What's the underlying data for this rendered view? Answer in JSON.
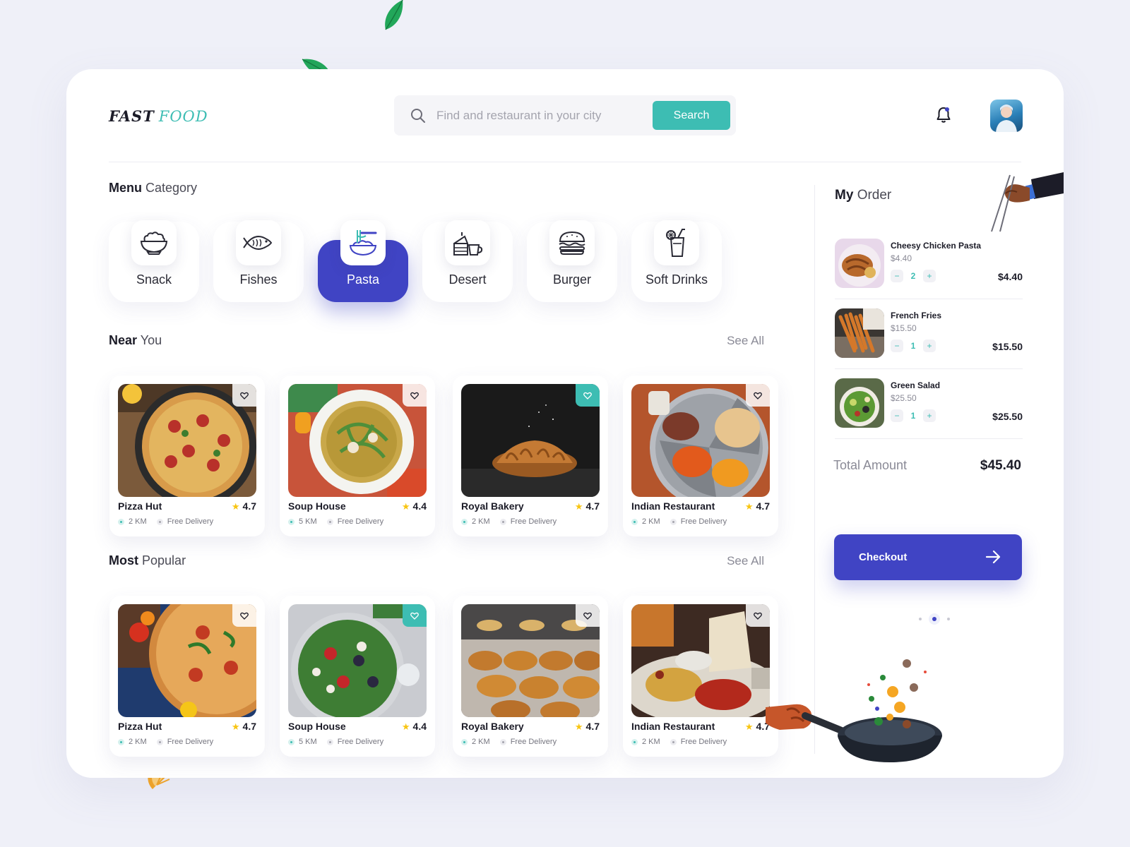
{
  "brand": {
    "part1": "FAST",
    "part2": "FOOD"
  },
  "search": {
    "placeholder": "Find and restaurant in your city",
    "button": "Search"
  },
  "menu": {
    "title_bold": "Menu",
    "title_rest": "Category",
    "categories": [
      {
        "label": "Snack",
        "icon": "salad-bowl-icon"
      },
      {
        "label": "Fishes",
        "icon": "fish-icon"
      },
      {
        "label": "Pasta",
        "icon": "noodle-bowl-icon",
        "active": true
      },
      {
        "label": "Desert",
        "icon": "cake-coffee-icon"
      },
      {
        "label": "Burger",
        "icon": "burger-icon"
      },
      {
        "label": "Soft Drinks",
        "icon": "drink-icon"
      }
    ]
  },
  "near": {
    "title_bold": "Near",
    "title_rest": "You",
    "see_all": "See All",
    "items": [
      {
        "name": "Pizza Hut",
        "rating": "4.7",
        "distance": "2 KM",
        "delivery": "Free Delivery",
        "favorite": false
      },
      {
        "name": "Soup House",
        "rating": "4.4",
        "distance": "5 KM",
        "delivery": "Free Delivery",
        "favorite": false
      },
      {
        "name": "Royal Bakery",
        "rating": "4.7",
        "distance": "2 KM",
        "delivery": "Free Delivery",
        "favorite": true
      },
      {
        "name": "Indian Restaurant",
        "rating": "4.7",
        "distance": "2 KM",
        "delivery": "Free Delivery",
        "favorite": false
      }
    ]
  },
  "popular": {
    "title_bold": "Most",
    "title_rest": "Popular",
    "see_all": "See All",
    "items": [
      {
        "name": "Pizza Hut",
        "rating": "4.7",
        "distance": "2 KM",
        "delivery": "Free Delivery",
        "favorite": false
      },
      {
        "name": "Soup House",
        "rating": "4.4",
        "distance": "5 KM",
        "delivery": "Free Delivery",
        "favorite": true
      },
      {
        "name": "Royal Bakery",
        "rating": "4.7",
        "distance": "2 KM",
        "delivery": "Free Delivery",
        "favorite": false
      },
      {
        "name": "Indian Restaurant",
        "rating": "4.7",
        "distance": "2 KM",
        "delivery": "Free Delivery",
        "favorite": false
      }
    ]
  },
  "order": {
    "title_bold": "My",
    "title_rest": "Order",
    "items": [
      {
        "name": "Cheesy Chicken Pasta",
        "price": "$4.40",
        "qty": "2",
        "total": "$4.40"
      },
      {
        "name": "French Fries",
        "price": "$15.50",
        "qty": "1",
        "total": "$15.50"
      },
      {
        "name": "Green Salad",
        "price": "$25.50",
        "qty": "1",
        "total": "$25.50"
      }
    ],
    "total_label": "Total Amount",
    "total_value": "$45.40",
    "checkout": "Checkout",
    "page_count": 3,
    "current_page": 2
  },
  "colors": {
    "accent": "#4044c4",
    "teal": "#3dbdb3",
    "star": "#f8c512"
  }
}
